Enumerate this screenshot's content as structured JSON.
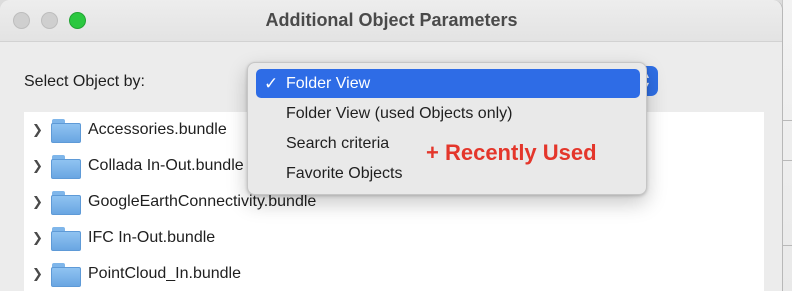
{
  "window": {
    "title": "Additional Object Parameters"
  },
  "select_object": {
    "label": "Select Object by:",
    "selected": "Folder View"
  },
  "dropdown": {
    "options": [
      {
        "label": "Folder View",
        "checked": true
      },
      {
        "label": "Folder View (used Objects only)",
        "checked": false
      },
      {
        "label": "Search criteria",
        "checked": false
      },
      {
        "label": "Favorite Objects",
        "checked": false
      }
    ],
    "check_glyph": "✓"
  },
  "annotation": {
    "text": "+ Recently Used",
    "color": "#e4362b"
  },
  "folder_tree": {
    "items": [
      {
        "label": "Accessories.bundle"
      },
      {
        "label": "Collada In-Out.bundle"
      },
      {
        "label": "GoogleEarthConnectivity.bundle"
      },
      {
        "label": "IFC In-Out.bundle"
      },
      {
        "label": "PointCloud_In.bundle"
      }
    ]
  },
  "colors": {
    "accent": "#2e6ce6",
    "folder": "#7fb6ea"
  }
}
